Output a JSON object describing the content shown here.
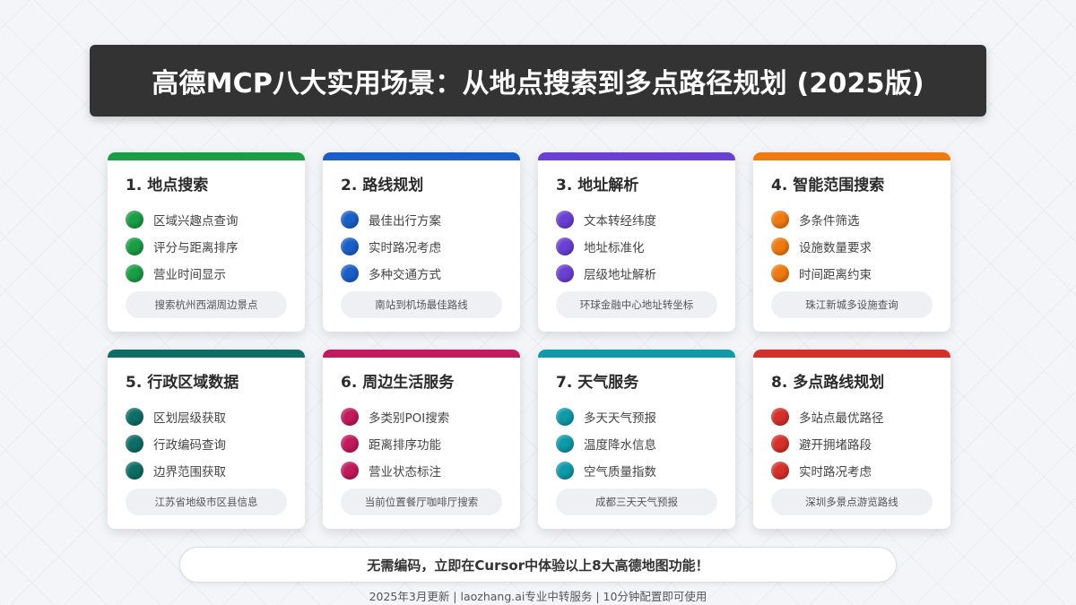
{
  "header": {
    "title": "高德MCP八大实用场景：从地点搜索到多点路径规划 (2025版)"
  },
  "cards": [
    {
      "title": "1. 地点搜索",
      "color": "#1a9e45",
      "items": [
        "区域兴趣点查询",
        "评分与距离排序",
        "营业时间显示"
      ],
      "example": "搜索杭州西湖周边景点"
    },
    {
      "title": "2. 路线规划",
      "color": "#1a5fc9",
      "items": [
        "最佳出行方案",
        "实时路况考虑",
        "多种交通方式"
      ],
      "example": "南站到机场最佳路线"
    },
    {
      "title": "3. 地址解析",
      "color": "#6a3fd3",
      "items": [
        "文本转经纬度",
        "地址标准化",
        "层级地址解析"
      ],
      "example": "环球金融中心地址转坐标"
    },
    {
      "title": "4. 智能范围搜索",
      "color": "#f07a10",
      "items": [
        "多条件筛选",
        "设施数量要求",
        "时间距离约束"
      ],
      "example": "珠江新城多设施查询"
    },
    {
      "title": "5. 行政区域数据",
      "color": "#0d6e66",
      "items": [
        "区划层级获取",
        "行政编码查询",
        "边界范围获取"
      ],
      "example": "江苏省地级市区县信息"
    },
    {
      "title": "6. 周边生活服务",
      "color": "#c21a5c",
      "items": [
        "多类别POI搜索",
        "距离排序功能",
        "营业状态标注"
      ],
      "example": "当前位置餐厅咖啡厅搜索"
    },
    {
      "title": "7. 天气服务",
      "color": "#0e9aa8",
      "items": [
        "多天天气预报",
        "温度降水信息",
        "空气质量指数"
      ],
      "example": "成都三天天气预报"
    },
    {
      "title": "8. 多点路线规划",
      "color": "#d6302a",
      "items": [
        "多站点最优路径",
        "避开拥堵路段",
        "实时路况考虑"
      ],
      "example": "深圳多景点游览路线"
    }
  ],
  "cta": {
    "text": "无需编码，立即在Cursor中体验以上8大高德地图功能！"
  },
  "footer": {
    "text": "2025年3月更新 | laozhang.ai专业中转服务 | 10分钟配置即可使用"
  }
}
